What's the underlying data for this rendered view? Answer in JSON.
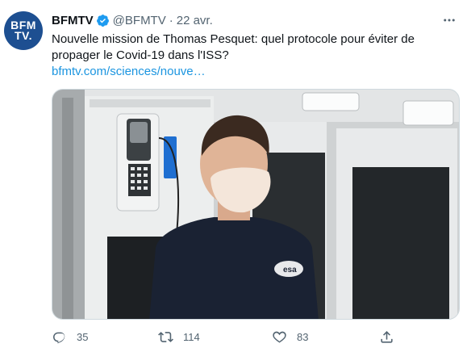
{
  "avatar": {
    "logo_line1": "BFM",
    "logo_line2": "TV."
  },
  "author": {
    "display_name": "BFMTV",
    "handle": "@BFMTV",
    "separator": "·",
    "time": "22 avr."
  },
  "tweet": {
    "text": "Nouvelle mission de Thomas Pesquet: quel protocole pour éviter de propager le Covid-19 dans l'ISS?",
    "link": "bfmtv.com/sciences/nouve…"
  },
  "media": {
    "patch_text": "esa"
  },
  "actions": {
    "replies": "35",
    "retweets": "114",
    "likes": "83"
  },
  "colors": {
    "link": "#1b95e0",
    "muted": "#536471",
    "verified": "#1d9bf0",
    "avatar_bg": "#1d4f91"
  },
  "icons": [
    "verified-badge-icon",
    "more-icon",
    "reply-icon",
    "retweet-icon",
    "like-icon",
    "share-icon"
  ]
}
